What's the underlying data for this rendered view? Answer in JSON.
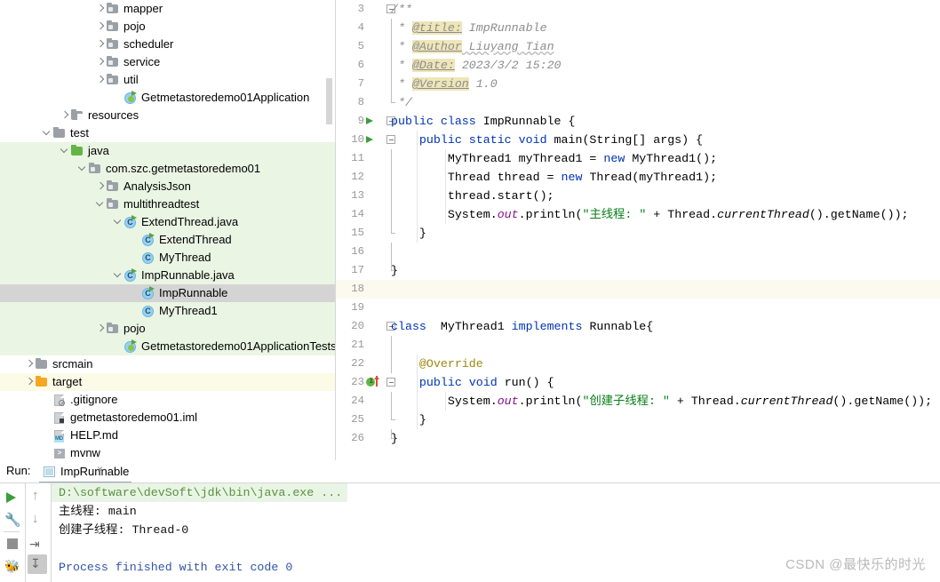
{
  "project_tree": {
    "rows": [
      {
        "indent": 5,
        "arrow": "right",
        "icon": "folder-package",
        "label": "mapper",
        "state": "srcroot_none"
      },
      {
        "indent": 5,
        "arrow": "right",
        "icon": "folder-package",
        "label": "pojo",
        "state": "none"
      },
      {
        "indent": 5,
        "arrow": "right",
        "icon": "folder-package",
        "label": "scheduler",
        "state": "none"
      },
      {
        "indent": 5,
        "arrow": "right",
        "icon": "folder-package",
        "label": "service",
        "state": "none"
      },
      {
        "indent": 5,
        "arrow": "right",
        "icon": "folder-package",
        "label": "util",
        "state": "none"
      },
      {
        "indent": 6,
        "arrow": "none",
        "icon": "class-spring-run",
        "label": "Getmetastoredemo01Application",
        "state": "none"
      },
      {
        "indent": 3,
        "arrow": "right",
        "icon": "folder-resources",
        "label": "resources",
        "state": "none"
      },
      {
        "indent": 2,
        "arrow": "down",
        "icon": "folder-grey",
        "label": "test",
        "state": "none"
      },
      {
        "indent": 3,
        "arrow": "down",
        "icon": "folder-green",
        "label": "java",
        "state": "srcroot"
      },
      {
        "indent": 4,
        "arrow": "down",
        "icon": "folder-package",
        "label": "com.szc.getmetastoredemo01",
        "state": "srcroot"
      },
      {
        "indent": 5,
        "arrow": "right",
        "icon": "folder-package",
        "label": "AnalysisJson",
        "state": "srcroot"
      },
      {
        "indent": 5,
        "arrow": "down",
        "icon": "folder-package",
        "label": "multithreadtest",
        "state": "srcroot"
      },
      {
        "indent": 6,
        "arrow": "down",
        "icon": "class-run",
        "label": "ExtendThread.java",
        "state": "srcroot"
      },
      {
        "indent": 7,
        "arrow": "none",
        "icon": "class-run",
        "label": "ExtendThread",
        "state": "srcroot"
      },
      {
        "indent": 7,
        "arrow": "none",
        "icon": "class",
        "label": "MyThread",
        "state": "srcroot"
      },
      {
        "indent": 6,
        "arrow": "down",
        "icon": "class-run",
        "label": "ImpRunnable.java",
        "state": "srcroot"
      },
      {
        "indent": 7,
        "arrow": "none",
        "icon": "class-run",
        "label": "ImpRunnable",
        "state": "selected"
      },
      {
        "indent": 7,
        "arrow": "none",
        "icon": "class",
        "label": "MyThread1",
        "state": "srcroot"
      },
      {
        "indent": 5,
        "arrow": "right",
        "icon": "folder-package",
        "label": "pojo",
        "state": "srcroot"
      },
      {
        "indent": 6,
        "arrow": "none",
        "icon": "class-spring-run",
        "label": "Getmetastoredemo01ApplicationTests",
        "state": "srcroot"
      },
      {
        "indent": 1,
        "arrow": "right",
        "icon": "folder-grey",
        "label": "srcmain",
        "state": "none"
      },
      {
        "indent": 1,
        "arrow": "right",
        "icon": "folder-orange",
        "label": "target",
        "state": "target"
      },
      {
        "indent": 2,
        "arrow": "none",
        "icon": "file-gitignore",
        "label": ".gitignore",
        "state": "none"
      },
      {
        "indent": 2,
        "arrow": "none",
        "icon": "file-iml",
        "label": "getmetastoredemo01.iml",
        "state": "none"
      },
      {
        "indent": 2,
        "arrow": "none",
        "icon": "file-md",
        "label": "HELP.md",
        "state": "none"
      },
      {
        "indent": 2,
        "arrow": "none",
        "icon": "file-shell",
        "label": "mvnw",
        "state": "none"
      }
    ]
  },
  "editor": {
    "file": "ImpRunnable.java",
    "first_line_number": 3,
    "lines": [
      {
        "n": 3,
        "gutter": "",
        "fold": "open-top",
        "indent_guides": [],
        "caret": false,
        "tokens": [
          {
            "t": "/**",
            "c": "cm"
          }
        ]
      },
      {
        "n": 4,
        "gutter": "",
        "fold": "bar",
        "indent_guides": [],
        "caret": false,
        "tokens": [
          {
            "t": " * ",
            "c": "cm"
          },
          {
            "t": "@title:",
            "c": "tag"
          },
          {
            "t": " ImpRunnable",
            "c": "cm"
          }
        ]
      },
      {
        "n": 5,
        "gutter": "",
        "fold": "bar",
        "indent_guides": [],
        "caret": false,
        "tokens": [
          {
            "t": " * ",
            "c": "cm"
          },
          {
            "t": "@Author",
            "c": "tag"
          },
          {
            "t": " Liuyang Tian",
            "c": "cm wavy"
          }
        ]
      },
      {
        "n": 6,
        "gutter": "",
        "fold": "bar",
        "indent_guides": [],
        "caret": false,
        "tokens": [
          {
            "t": " * ",
            "c": "cm"
          },
          {
            "t": "@Date:",
            "c": "tag"
          },
          {
            "t": " 2023/3/2 15:20",
            "c": "cm"
          }
        ]
      },
      {
        "n": 7,
        "gutter": "",
        "fold": "bar",
        "indent_guides": [],
        "caret": false,
        "tokens": [
          {
            "t": " * ",
            "c": "cm"
          },
          {
            "t": "@Version",
            "c": "tag"
          },
          {
            "t": " 1.0",
            "c": "cm"
          }
        ]
      },
      {
        "n": 8,
        "gutter": "",
        "fold": "close-bottom",
        "indent_guides": [],
        "caret": false,
        "tokens": [
          {
            "t": " */",
            "c": "cm"
          }
        ]
      },
      {
        "n": 9,
        "gutter": "run",
        "fold": "open-top",
        "indent_guides": [],
        "caret": false,
        "tokens": [
          {
            "t": "public class ",
            "c": "kw"
          },
          {
            "t": "ImpRunnable {",
            "c": ""
          }
        ]
      },
      {
        "n": 10,
        "gutter": "run",
        "fold": "open-mid",
        "indent_guides": [
          0
        ],
        "caret": false,
        "tokens": [
          {
            "t": "    ",
            "c": ""
          },
          {
            "t": "public static void ",
            "c": "kw"
          },
          {
            "t": "main(String[] args) {",
            "c": ""
          }
        ]
      },
      {
        "n": 11,
        "gutter": "",
        "fold": "bar",
        "indent_guides": [
          0,
          1
        ],
        "caret": false,
        "tokens": [
          {
            "t": "        MyThread1 myThread1 = ",
            "c": ""
          },
          {
            "t": "new ",
            "c": "kw"
          },
          {
            "t": "MyThread1();",
            "c": ""
          }
        ]
      },
      {
        "n": 12,
        "gutter": "",
        "fold": "bar",
        "indent_guides": [
          0,
          1
        ],
        "caret": false,
        "tokens": [
          {
            "t": "        Thread thread = ",
            "c": ""
          },
          {
            "t": "new ",
            "c": "kw"
          },
          {
            "t": "Thread(myThread1);",
            "c": ""
          }
        ]
      },
      {
        "n": 13,
        "gutter": "",
        "fold": "bar",
        "indent_guides": [
          0,
          1
        ],
        "caret": false,
        "tokens": [
          {
            "t": "        thread.start();",
            "c": ""
          }
        ]
      },
      {
        "n": 14,
        "gutter": "",
        "fold": "bar",
        "indent_guides": [
          0,
          1
        ],
        "caret": false,
        "tokens": [
          {
            "t": "        System.",
            "c": ""
          },
          {
            "t": "out",
            "c": "stat"
          },
          {
            "t": ".println(",
            "c": ""
          },
          {
            "t": "\"主线程: \"",
            "c": "str"
          },
          {
            "t": " + Thread.",
            "c": ""
          },
          {
            "t": "currentThread",
            "c": "ital"
          },
          {
            "t": "().getName());",
            "c": ""
          }
        ]
      },
      {
        "n": 15,
        "gutter": "",
        "fold": "close-bottom",
        "indent_guides": [
          0
        ],
        "caret": false,
        "tokens": [
          {
            "t": "    }",
            "c": ""
          }
        ]
      },
      {
        "n": 16,
        "gutter": "",
        "fold": "bar",
        "indent_guides": [],
        "caret": false,
        "tokens": []
      },
      {
        "n": 17,
        "gutter": "",
        "fold": "close-bottom",
        "indent_guides": [],
        "caret": false,
        "tokens": [
          {
            "t": "}",
            "c": ""
          }
        ]
      },
      {
        "n": 18,
        "gutter": "",
        "fold": "",
        "indent_guides": [],
        "caret": true,
        "tokens": []
      },
      {
        "n": 19,
        "gutter": "",
        "fold": "",
        "indent_guides": [],
        "caret": false,
        "tokens": []
      },
      {
        "n": 20,
        "gutter": "",
        "fold": "open-top",
        "indent_guides": [],
        "caret": false,
        "tokens": [
          {
            "t": "class ",
            "c": "kw"
          },
          {
            "t": " MyThread1 ",
            "c": ""
          },
          {
            "t": "implements ",
            "c": "kw"
          },
          {
            "t": "Runnable{",
            "c": ""
          }
        ]
      },
      {
        "n": 21,
        "gutter": "",
        "fold": "bar",
        "indent_guides": [],
        "caret": false,
        "tokens": []
      },
      {
        "n": 22,
        "gutter": "",
        "fold": "bar",
        "indent_guides": [
          0
        ],
        "caret": false,
        "tokens": [
          {
            "t": "    ",
            "c": ""
          },
          {
            "t": "@Override",
            "c": "ann"
          }
        ]
      },
      {
        "n": 23,
        "gutter": "impl",
        "fold": "open-mid",
        "indent_guides": [
          0
        ],
        "caret": false,
        "tokens": [
          {
            "t": "    ",
            "c": ""
          },
          {
            "t": "public void ",
            "c": "kw"
          },
          {
            "t": "run() {",
            "c": ""
          }
        ]
      },
      {
        "n": 24,
        "gutter": "",
        "fold": "bar",
        "indent_guides": [
          0,
          1
        ],
        "caret": false,
        "tokens": [
          {
            "t": "        System.",
            "c": ""
          },
          {
            "t": "out",
            "c": "stat"
          },
          {
            "t": ".println(",
            "c": ""
          },
          {
            "t": "\"创建子线程: \"",
            "c": "str"
          },
          {
            "t": " + Thread.",
            "c": ""
          },
          {
            "t": "currentThread",
            "c": "ital"
          },
          {
            "t": "().getName());",
            "c": ""
          }
        ]
      },
      {
        "n": 25,
        "gutter": "",
        "fold": "close-bottom",
        "indent_guides": [
          0
        ],
        "caret": false,
        "tokens": [
          {
            "t": "    }",
            "c": ""
          }
        ]
      },
      {
        "n": 26,
        "gutter": "",
        "fold": "close-bottom",
        "indent_guides": [],
        "caret": false,
        "tokens": [
          {
            "t": "}",
            "c": ""
          }
        ]
      }
    ]
  },
  "run_panel": {
    "title": "Run:",
    "tab_label": "ImpRunnable",
    "close_label": "×",
    "toolbar_left": [
      {
        "name": "rerun-button",
        "icon": "run-icon"
      },
      {
        "name": "edit-configurations-button",
        "icon": "wrench-icon"
      },
      {
        "name": "stop-button",
        "icon": "stop-icon"
      },
      {
        "name": "rerun-failed-tests-button",
        "icon": "bug-icon"
      }
    ],
    "toolbar_right": [
      {
        "name": "up-stack-trace-button",
        "icon": "arrow-up-icon",
        "glyph": "↑"
      },
      {
        "name": "down-stack-trace-button",
        "icon": "arrow-down-icon",
        "glyph": "↓"
      },
      {
        "name": "soft-wrap-button",
        "icon": "soft-wrap-icon",
        "glyph": "⇥"
      },
      {
        "name": "scroll-to-end-button",
        "icon": "scroll-end-icon",
        "glyph": "↧"
      }
    ],
    "console_lines": [
      {
        "text": "D:\\software\\devSoft\\jdk\\bin\\java.exe ...",
        "style": "cmd"
      },
      {
        "text": "主线程: main",
        "style": "plain"
      },
      {
        "text": "创建子线程: Thread-0",
        "style": "plain"
      },
      {
        "text": "",
        "style": "plain"
      },
      {
        "text": "Process finished with exit code 0",
        "style": "blue"
      }
    ]
  },
  "watermark": {
    "text": "CSDN @最快乐的时光"
  },
  "colors": {
    "source_root_bg": "#eaf5e4",
    "target_bg": "#fcfbe7",
    "selection_bg": "#d4d4d4",
    "caret_row_bg": "#fcfaee",
    "keyword": "#0033b3",
    "string": "#067d17",
    "comment": "#8c8c8c",
    "javadoc_tag_bg": "#efe6b8",
    "annotation": "#9e880d",
    "static_field": "#871094",
    "console_cmd_bg": "#e9f5e4",
    "console_blue": "#2f54a8",
    "run_green": "#3c9d3c"
  }
}
